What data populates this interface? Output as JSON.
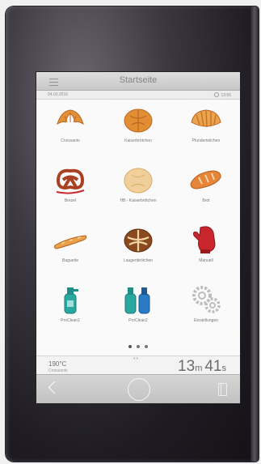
{
  "header": {
    "title": "Startseite"
  },
  "status": {
    "date": "04.03.2016",
    "time": "13:56"
  },
  "tiles": [
    {
      "label": "Croissants",
      "icon": "croissant-icon"
    },
    {
      "label": "Kaiserbrötchen",
      "icon": "roll-icon"
    },
    {
      "label": "Plunderteilchen",
      "icon": "pastry-icon"
    },
    {
      "label": "Brezel",
      "icon": "pretzel-icon"
    },
    {
      "label": "HB - Kaiserbrötchen",
      "icon": "bun-icon"
    },
    {
      "label": "Brot",
      "icon": "bread-icon"
    },
    {
      "label": "Baguette",
      "icon": "baguette-icon"
    },
    {
      "label": "Laugenbrötchen",
      "icon": "lye-roll-icon"
    },
    {
      "label": "Manuell",
      "icon": "oven-mitt-icon"
    },
    {
      "label": "ProClean1",
      "icon": "cleaner-bottle-icon"
    },
    {
      "label": "ProClean2",
      "icon": "cleaner-bottles-icon"
    },
    {
      "label": "Einstellungen",
      "icon": "gears-icon"
    }
  ],
  "pager": {
    "count": 3,
    "active": 0
  },
  "bottom": {
    "temperature": "190°C",
    "program": "Croissants",
    "minutes": "13",
    "minutes_unit": "m",
    "seconds": "41",
    "seconds_unit": "s"
  },
  "colors": {
    "bread": "#e08a2c",
    "bread_dark": "#b9601a",
    "red": "#c8262c",
    "cleaner": "#2aa7a0",
    "cleaner_blue": "#2a7bc4",
    "gear": "#bdbdbd"
  }
}
